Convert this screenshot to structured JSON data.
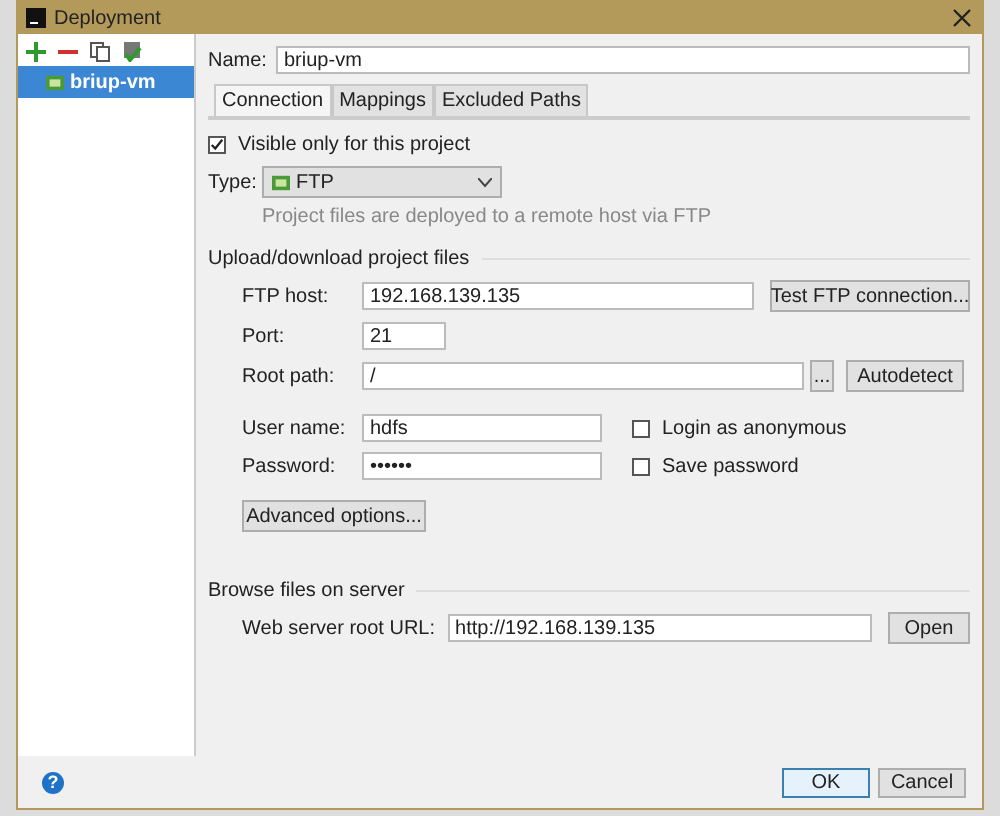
{
  "window": {
    "title": "Deployment"
  },
  "sidebar": {
    "items": [
      {
        "label": "briup-vm",
        "selected": true
      }
    ]
  },
  "name_field": {
    "label": "Name:",
    "value": "briup-vm"
  },
  "tabs": [
    {
      "label": "Connection",
      "selected": true
    },
    {
      "label": "Mappings",
      "selected": false
    },
    {
      "label": "Excluded Paths",
      "selected": false
    }
  ],
  "visible_only": {
    "label": "Visible only for this project",
    "checked": true
  },
  "type": {
    "label": "Type:",
    "value": "FTP",
    "hint": "Project files are deployed to a remote host via FTP"
  },
  "upload_section": {
    "title": "Upload/download project files",
    "ftp_host": {
      "label": "FTP host:",
      "value": "192.168.139.135",
      "button": "Test FTP connection..."
    },
    "port": {
      "label": "Port:",
      "value": "21"
    },
    "root_path": {
      "label": "Root path:",
      "value": "/",
      "browse": "...",
      "button": "Autodetect"
    },
    "user_name": {
      "label": "User name:",
      "value": "hdfs",
      "option": {
        "label": "Login as anonymous",
        "checked": false
      }
    },
    "password": {
      "label": "Password:",
      "value": "••••••",
      "option": {
        "label": "Save password",
        "checked": false
      }
    },
    "advanced": "Advanced options..."
  },
  "browse_section": {
    "title": "Browse files on server",
    "url": {
      "label": "Web server root URL:",
      "value": "http://192.168.139.135",
      "button": "Open"
    }
  },
  "footer": {
    "help": "?",
    "buttons": [
      {
        "label": "OK",
        "default": true
      },
      {
        "label": "Cancel",
        "default": false
      }
    ]
  }
}
